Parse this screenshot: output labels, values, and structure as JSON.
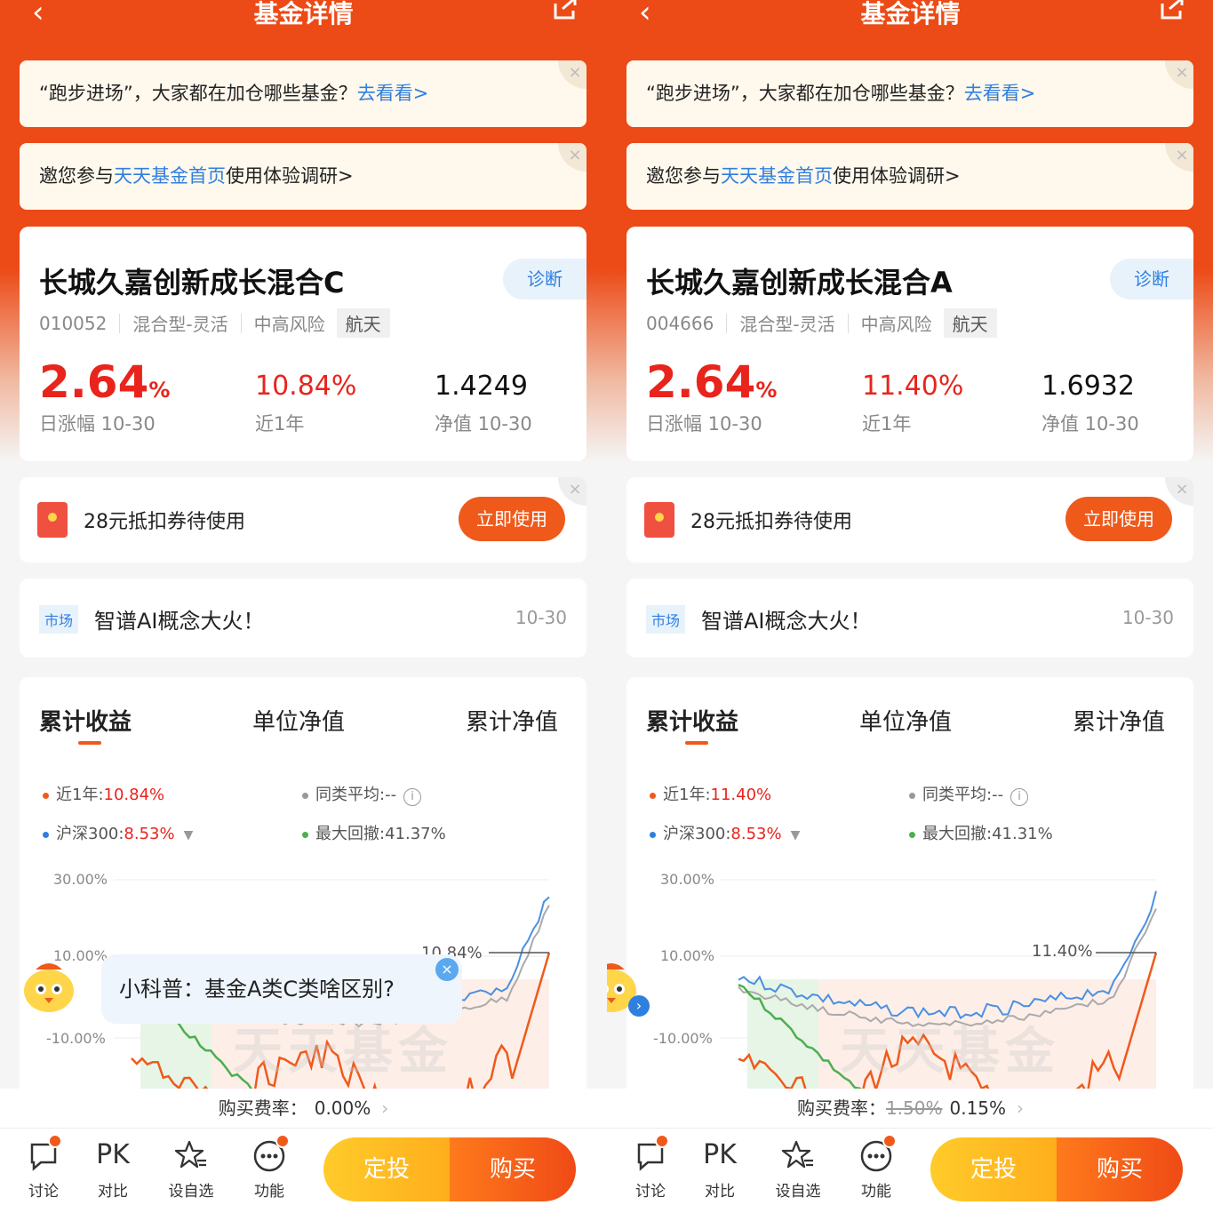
{
  "header": {
    "title": "基金详情",
    "back_icon": "‹"
  },
  "banner1": {
    "text": "“跑步进场”，大家都在加仓哪些基金？",
    "link": "去看看>"
  },
  "banner2": {
    "prefix": "邀您参与",
    "link": "天天基金首页",
    "suffix": "使用体验调研>"
  },
  "panels": [
    {
      "fund_name": "长城久嘉创新成长混合C",
      "diagnose": "诊断",
      "code": "010052",
      "type": "混合型-灵活",
      "risk": "中高风险",
      "theme": "航天",
      "daily_change": "2.64",
      "daily_change_unit": "%",
      "daily_label": "日涨幅 10-30",
      "year_return": "10.84%",
      "year_label": "近1年",
      "nav": "1.4249",
      "nav_label": "净值 10-30",
      "chart_peak_label": "10.84%",
      "legend_year_label": "近1年:",
      "legend_year_value": "10.84%",
      "legend_avg_label": "同类平均:",
      "legend_avg_value": "--",
      "legend_hs_label": "沪深300:",
      "legend_hs_value": "8.53%",
      "legend_dd_label": "最大回撤:",
      "legend_dd_value": "41.37%",
      "fee_label": "购买费率：",
      "fee_old": "",
      "fee_value": "0.00%"
    },
    {
      "fund_name": "长城久嘉创新成长混合A",
      "diagnose": "诊断",
      "code": "004666",
      "type": "混合型-灵活",
      "risk": "中高风险",
      "theme": "航天",
      "daily_change": "2.64",
      "daily_change_unit": "%",
      "daily_label": "日涨幅 10-30",
      "year_return": "11.40%",
      "year_label": "近1年",
      "nav": "1.6932",
      "nav_label": "净值 10-30",
      "chart_peak_label": "11.40%",
      "legend_year_label": "近1年:",
      "legend_year_value": "11.40%",
      "legend_avg_label": "同类平均:",
      "legend_avg_value": "--",
      "legend_hs_label": "沪深300:",
      "legend_hs_value": "8.53%",
      "legend_dd_label": "最大回撤:",
      "legend_dd_value": "41.31%",
      "fee_label": "购买费率：",
      "fee_old": "1.50%",
      "fee_value": "0.15%"
    }
  ],
  "coupon": {
    "text": "28元抵扣券待使用",
    "button": "立即使用"
  },
  "market": {
    "tag": "市场",
    "text": "智谱AI概念大火！",
    "date": "10-30"
  },
  "tabs": [
    "累计收益",
    "单位净值",
    "累计净值"
  ],
  "chart_axis": [
    "30.00%",
    "10.00%",
    "-10.00%"
  ],
  "watermark": "天天基金",
  "tip": {
    "text": "小科普：基金A类C类啥区别?"
  },
  "bottom_nav": [
    {
      "label": "讨论",
      "icon": "chat-icon"
    },
    {
      "label": "对比",
      "icon": "pk-icon",
      "glyph": "PK"
    },
    {
      "label": "设自选",
      "icon": "star-icon"
    },
    {
      "label": "功能",
      "icon": "more-icon"
    }
  ],
  "actions": {
    "invest": "定投",
    "buy": "购买"
  },
  "colors": {
    "brand": "#ec4a16",
    "red": "#e8241c",
    "blue": "#2f7fe0",
    "orange_line": "#ef5a1b",
    "blue_line": "#4a90e2",
    "grey_line": "#999999",
    "green_line": "#4caf50"
  },
  "chart_data": [
    {
      "type": "line",
      "title": "",
      "y_ticks": [
        "30.00%",
        "10.00%",
        "-10.00%"
      ],
      "ylim": [
        -30,
        30
      ],
      "series": [
        {
          "name": "近1年",
          "color": "#ef5a1b",
          "end_value": 10.84
        },
        {
          "name": "同类平均",
          "color": "#999999"
        },
        {
          "name": "沪深300",
          "color": "#4a90e2",
          "end_value": 8.53
        },
        {
          "name": "最大回撤",
          "color": "#4caf50",
          "value": 41.37
        }
      ]
    },
    {
      "type": "line",
      "title": "",
      "y_ticks": [
        "30.00%",
        "10.00%",
        "-10.00%"
      ],
      "ylim": [
        -30,
        30
      ],
      "series": [
        {
          "name": "近1年",
          "color": "#ef5a1b",
          "end_value": 11.4
        },
        {
          "name": "同类平均",
          "color": "#999999"
        },
        {
          "name": "沪深300",
          "color": "#4a90e2",
          "end_value": 8.53
        },
        {
          "name": "最大回撤",
          "color": "#4caf50",
          "value": 41.31
        }
      ]
    }
  ]
}
